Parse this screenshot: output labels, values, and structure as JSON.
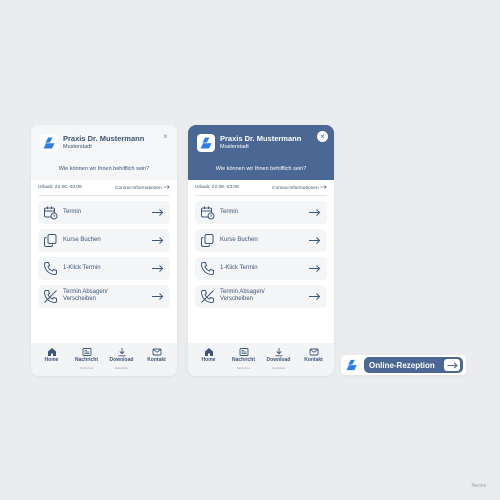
{
  "colors": {
    "background": "#ebecee",
    "primary": "#4b6894",
    "text": "#3e5678",
    "card": "#f4f5f7",
    "logo_blue": "#2b7de9"
  },
  "practice": {
    "name": "Praxis Dr. Mustermann",
    "city": "Musterstadt"
  },
  "question": "Wie können wir Ihnen behilflich sein?",
  "info": {
    "vacation": "Urlaub: 22.06.-03.08",
    "corona": "Corona-Informationen"
  },
  "close_icon": "×",
  "actions": [
    {
      "label": "Termin",
      "icon": "calendar-clock-icon"
    },
    {
      "label": "Kurse Buchen",
      "icon": "copy-icon"
    },
    {
      "label": "1-Klick Termin",
      "icon": "phone-icon"
    },
    {
      "label": "Termin Absagen/ Verscheiben",
      "icon": "phone-off-icon"
    }
  ],
  "nav": [
    {
      "label": "Home",
      "sub": "",
      "icon": "home-icon"
    },
    {
      "label": "Nachricht",
      "sub": "Nachrichten",
      "icon": "newspaper-icon"
    },
    {
      "label": "Download",
      "sub": "Datenblätter",
      "icon": "download-icon"
    },
    {
      "label": "Kontakt",
      "sub": "",
      "icon": "mail-icon"
    }
  ],
  "launcher": {
    "label": "Online-Rezeption"
  },
  "signature": "Neons"
}
